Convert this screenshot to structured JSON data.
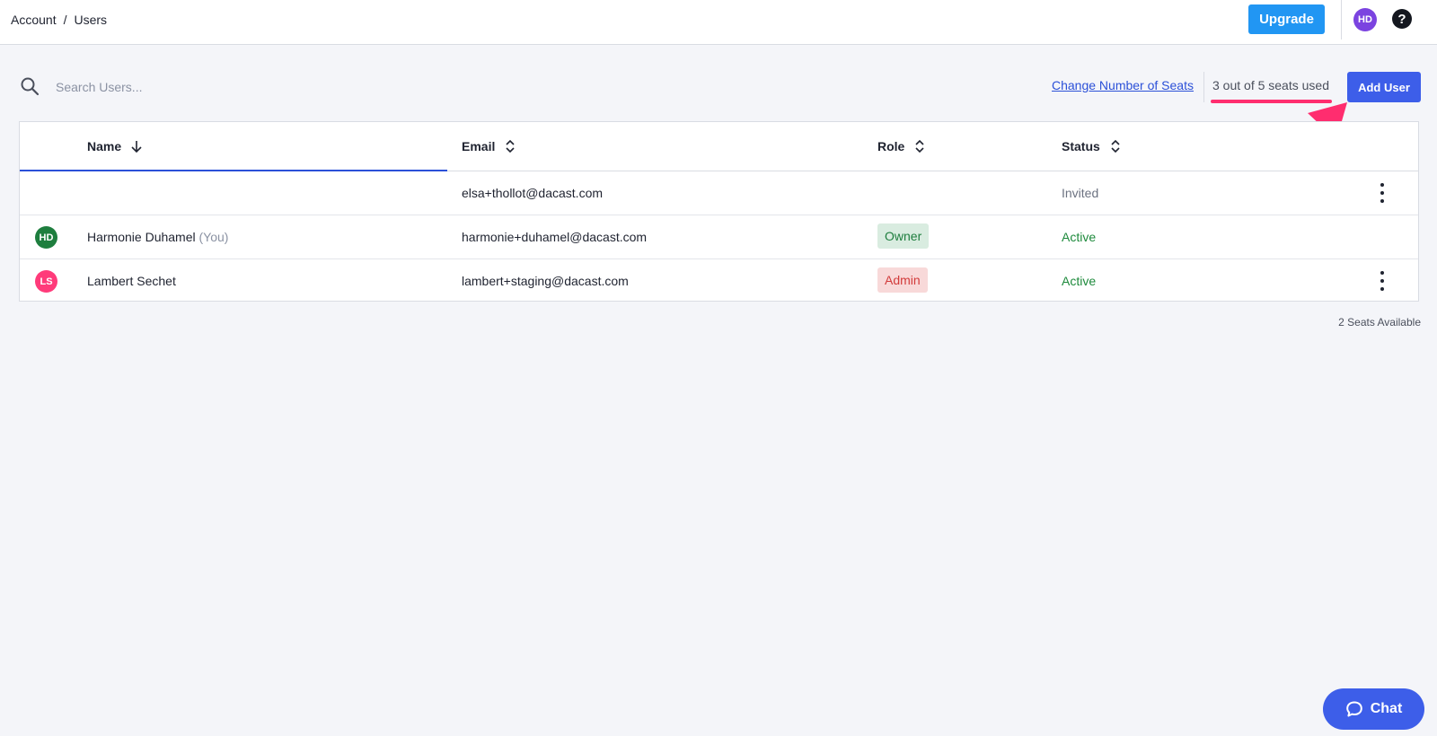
{
  "breadcrumb": {
    "items": [
      "Account",
      "Users"
    ],
    "separator": "/"
  },
  "header": {
    "upgrade_label": "Upgrade",
    "avatar_initials": "HD",
    "help_glyph": "?"
  },
  "toolbar": {
    "search_placeholder": "Search Users...",
    "change_seats_label": "Change Number of Seats",
    "seats_used_label": "3 out of 5 seats used",
    "add_user_label": "Add User"
  },
  "table": {
    "columns": [
      "Name",
      "Email",
      "Role",
      "Status"
    ],
    "rows": [
      {
        "initials": "",
        "name": "",
        "you": "",
        "email": "elsa+thollot@dacast.com",
        "role": "",
        "status": "Invited"
      },
      {
        "initials": "HD",
        "name": "Harmonie Duhamel",
        "you": "(You)",
        "email": "harmonie+duhamel@dacast.com",
        "role": "Owner",
        "status": "Active"
      },
      {
        "initials": "LS",
        "name": "Lambert Sechet",
        "you": "",
        "email": "lambert+staging@dacast.com",
        "role": "Admin",
        "status": "Active"
      }
    ]
  },
  "footer": {
    "seats_available": "2 Seats Available"
  },
  "chat": {
    "label": "Chat"
  },
  "colors": {
    "accent": "#3d5ee9",
    "upgrade": "#2196f3",
    "annotation": "#ff2d6f",
    "avatar_hd": "#1e7e3e",
    "avatar_ls": "#ff3b7a"
  }
}
